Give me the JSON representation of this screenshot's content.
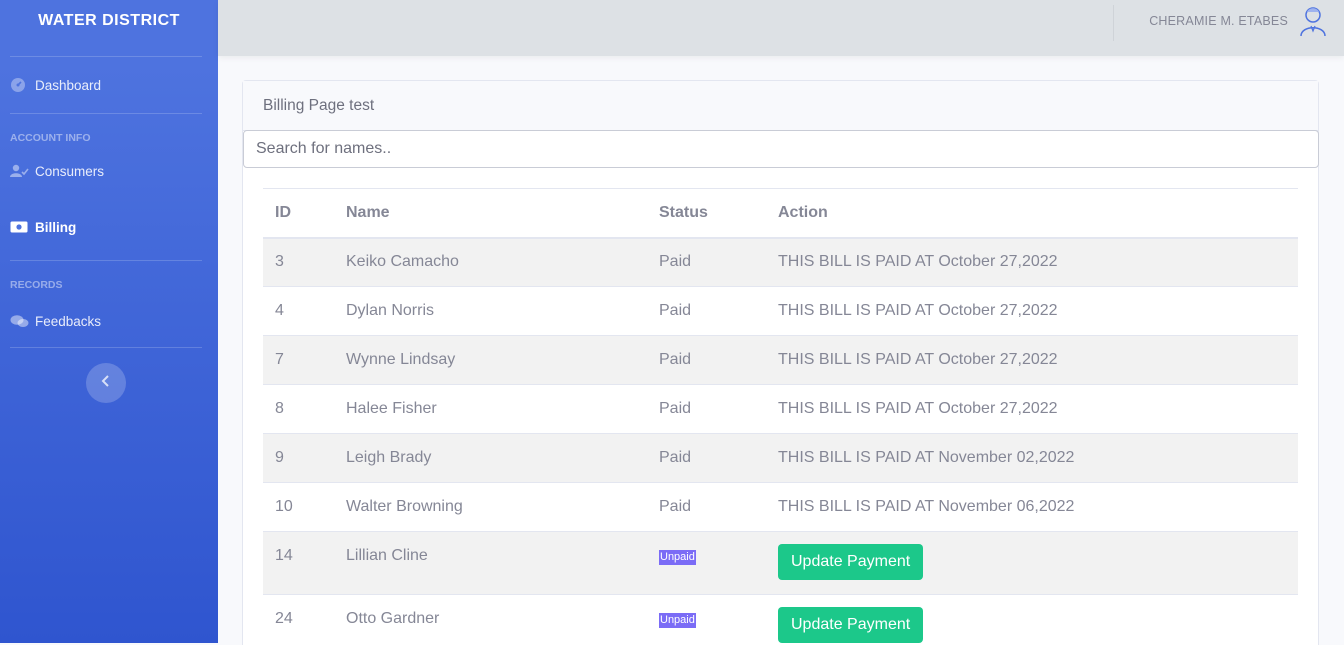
{
  "brand": "WATER DISTRICT",
  "sidebar": {
    "dashboard": "Dashboard",
    "heading_account": "ACCOUNT INFO",
    "consumers": "Consumers",
    "billing": "Billing",
    "heading_records": "RECORDS",
    "feedbacks": "Feedbacks"
  },
  "topbar": {
    "user_name": "CHERAMIE M. ETABES"
  },
  "card": {
    "title": "Billing Page test",
    "search_placeholder": "Search for names.."
  },
  "table": {
    "headers": {
      "id": "ID",
      "name": "Name",
      "status": "Status",
      "action": "Action"
    },
    "rows": [
      {
        "id": "3",
        "name": "Keiko Camacho",
        "status": "Paid",
        "action": "THIS BILL IS PAID AT October 27,2022"
      },
      {
        "id": "4",
        "name": "Dylan Norris",
        "status": "Paid",
        "action": "THIS BILL IS PAID AT October 27,2022"
      },
      {
        "id": "7",
        "name": "Wynne Lindsay",
        "status": "Paid",
        "action": "THIS BILL IS PAID AT October 27,2022"
      },
      {
        "id": "8",
        "name": "Halee Fisher",
        "status": "Paid",
        "action": "THIS BILL IS PAID AT October 27,2022"
      },
      {
        "id": "9",
        "name": "Leigh Brady",
        "status": "Paid",
        "action": "THIS BILL IS PAID AT November 02,2022"
      },
      {
        "id": "10",
        "name": "Walter Browning",
        "status": "Paid",
        "action": "THIS BILL IS PAID AT November 06,2022"
      },
      {
        "id": "14",
        "name": "Lillian Cline",
        "status": "Unpaid",
        "action": "Update Payment"
      },
      {
        "id": "24",
        "name": "Otto Gardner",
        "status": "Unpaid",
        "action": "Update Payment"
      }
    ]
  },
  "colors": {
    "sidebar": "#4e73df",
    "success": "#1cc88a",
    "badge": "#7b6cf6"
  }
}
